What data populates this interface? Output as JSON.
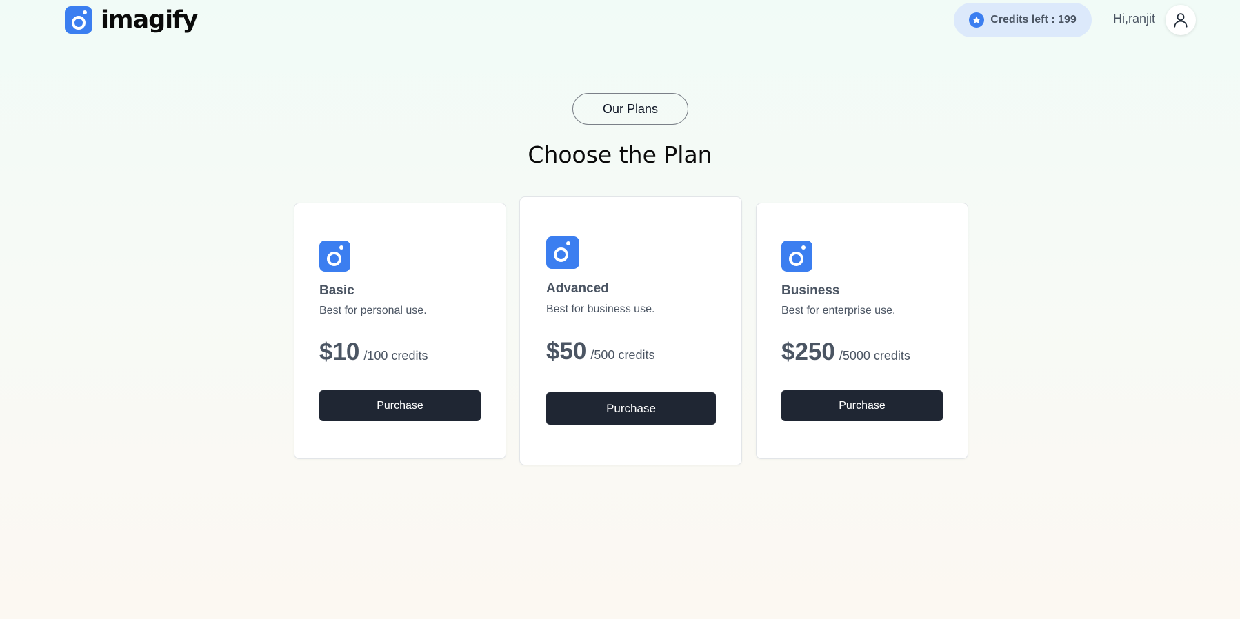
{
  "header": {
    "logo_text": "imagify",
    "logo_icon": "camera-icon",
    "credits_label": "Credits left : 199",
    "credits_icon": "star-icon",
    "greeting": "Hi,ranjit",
    "avatar_icon": "user-icon"
  },
  "section": {
    "badge": "Our Plans",
    "title": "Choose the Plan"
  },
  "plans": [
    {
      "name": "Basic",
      "description": "Best for personal use.",
      "price": "$10",
      "credits": "/100 credits",
      "button_label": "Purchase"
    },
    {
      "name": "Advanced",
      "description": "Best for business use.",
      "price": "$50",
      "credits": "/500 credits",
      "button_label": "Purchase"
    },
    {
      "name": "Business",
      "description": "Best for enterprise use.",
      "price": "$250",
      "credits": "/5000 credits",
      "button_label": "Purchase"
    }
  ],
  "colors": {
    "accent": "#3b7ef0",
    "button": "#1f2633",
    "credits_pill": "#dce9fb",
    "text_muted": "#4b5563"
  }
}
